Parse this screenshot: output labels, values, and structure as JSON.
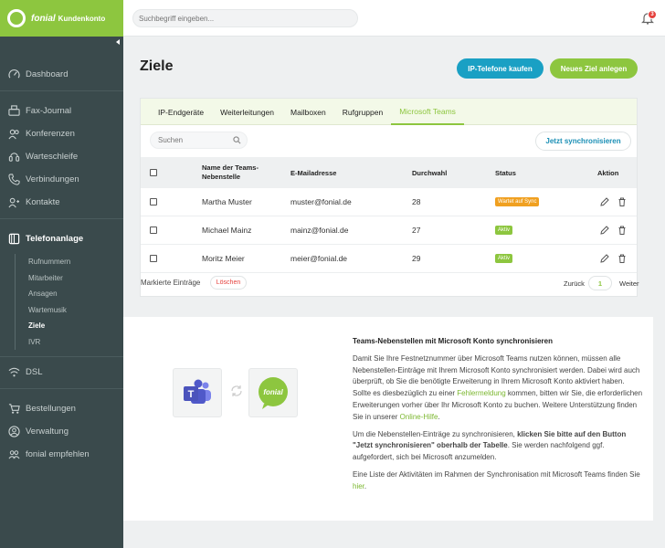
{
  "brand": {
    "name": "fonial",
    "subtitle": "Kundenkonto"
  },
  "topbar": {
    "search_placeholder": "Suchbegriff eingeben...",
    "notification_count": "3"
  },
  "sidebar": {
    "items": [
      {
        "label": "Dashboard",
        "icon": "dashboard-icon"
      },
      {
        "label": "Fax-Journal",
        "icon": "fax-icon"
      },
      {
        "label": "Konferenzen",
        "icon": "conference-icon"
      },
      {
        "label": "Warteschleife",
        "icon": "queue-icon"
      },
      {
        "label": "Verbindungen",
        "icon": "phone-icon"
      },
      {
        "label": "Kontakte",
        "icon": "contacts-icon"
      },
      {
        "label": "Telefonanlage",
        "icon": "pbx-icon"
      },
      {
        "label": "DSL",
        "icon": "wifi-icon"
      },
      {
        "label": "Bestellungen",
        "icon": "cart-icon"
      },
      {
        "label": "Verwaltung",
        "icon": "user-icon"
      },
      {
        "label": "fonial empfehlen",
        "icon": "recommend-icon"
      }
    ],
    "subitems": [
      "Rufnummern",
      "Mitarbeiter",
      "Ansagen",
      "Wartemusik",
      "Ziele",
      "IVR"
    ]
  },
  "main": {
    "title": "Ziele",
    "btn_ip": "IP-Telefone kaufen",
    "btn_new": "Neues Ziel anlegen",
    "tabs": [
      "IP-Endgeräte",
      "Weiterleitungen",
      "Mailboxen",
      "Rufgruppen",
      "Microsoft Teams"
    ],
    "table_search_placeholder": "Suchen",
    "sync_button": "Jetzt synchronisieren",
    "columns": {
      "name": "Name der Teams-Nebenstelle",
      "email": "E-Mailadresse",
      "ext": "Durchwahl",
      "status": "Status",
      "action": "Aktion"
    },
    "rows": [
      {
        "name": "Martha Muster",
        "email": "muster@fonial.de",
        "ext": "28",
        "status": "Wartet auf Sync"
      },
      {
        "name": "Michael Mainz",
        "email": "mainz@fonial.de",
        "ext": "27",
        "status": "Aktiv"
      },
      {
        "name": "Moritz Meier",
        "email": "meier@fonial.de",
        "ext": "29",
        "status": "Aktiv"
      }
    ],
    "marked_label": "Markierte Einträge",
    "delete_label": "Löschen",
    "pager": {
      "prev": "Zurück",
      "page": "1",
      "next": "Weiter"
    }
  },
  "info": {
    "title": "Teams-Nebenstellen mit Microsoft Konto synchronisieren",
    "p1a": "Damit Sie Ihre Festnetznummer über Microsoft Teams nutzen können, müssen alle Nebenstellen-Einträge mit Ihrem Microsoft Konto synchronisiert werden. Dabei wird auch überprüft, ob Sie die benötigte Erweiterung in Ihrem Microsoft Konto aktiviert haben. Sollte es diesbezüglich zu einer ",
    "p1_link1": "Fehlermeldung",
    "p1b": " kommen, bitten wir Sie, die erforderlichen Erweiterungen vorher über Ihr Microsoft Konto zu buchen. Weitere Unterstützung finden Sie in unserer ",
    "p1_link2": "Online-Hilfe",
    "p1c": ".",
    "p2a": "Um die Nebenstellen-Einträge zu synchronisieren, ",
    "p2_bold": "klicken Sie bitte auf den Button \"Jetzt synchronisieren\" oberhalb der Tabelle",
    "p2b": ". Sie werden nachfolgend ggf. aufgefordert, sich bei Microsoft anzumelden.",
    "p3a": "Eine Liste der Aktivitäten im Rahmen der Synchronisation mit Microsoft Teams finden Sie ",
    "p3_link": "hier",
    "p3b": ".",
    "teams_logo_letter": "T",
    "fonial_logo_text": "fonial"
  },
  "colors": {
    "brand_green": "#8dc63f",
    "blue": "#1aa0c4",
    "sidebar": "#3a4a4c",
    "orange": "#f0a020",
    "red": "#e5413d"
  }
}
